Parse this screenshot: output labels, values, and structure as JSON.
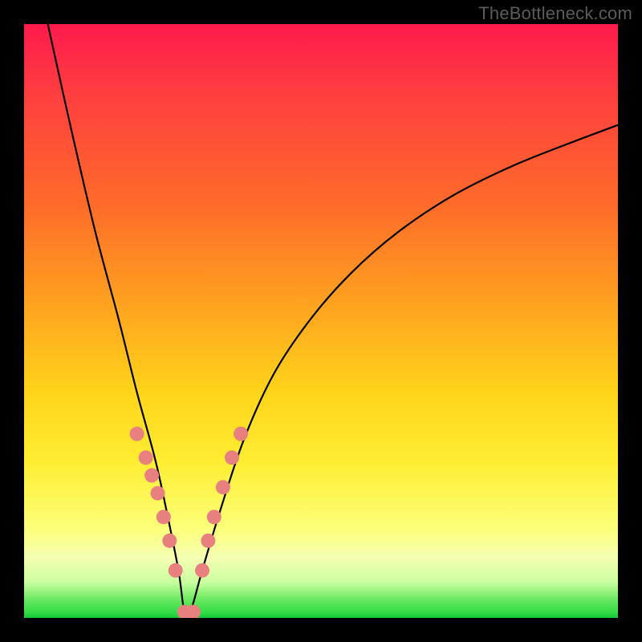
{
  "watermark": "TheBottleneck.com",
  "colors": {
    "frame": "#000000",
    "curve": "#000000",
    "dot": "#e98080",
    "gradient_top": "#ff1a4d",
    "gradient_bottom": "#15c93a"
  },
  "chart_data": {
    "type": "line",
    "title": "",
    "xlabel": "",
    "ylabel": "",
    "xlim": [
      0,
      100
    ],
    "ylim": [
      0,
      100
    ],
    "grid": false,
    "legend": false,
    "note": "Axes have no visible tick labels; values are estimated on a 0–100 scale from pixel positions. Curve is a V-shaped bottleneck profile with its minimum near x≈27, y≈0.",
    "series": [
      {
        "name": "bottleneck-curve",
        "x": [
          4,
          8,
          12,
          16,
          19,
          22,
          24,
          26,
          27,
          28,
          30,
          33,
          37,
          42,
          48,
          55,
          63,
          72,
          82,
          92,
          100
        ],
        "y": [
          100,
          82,
          65,
          50,
          38,
          27,
          18,
          8,
          1,
          1,
          8,
          18,
          30,
          41,
          50,
          58,
          65,
          71,
          76,
          80,
          83
        ]
      }
    ],
    "markers": {
      "name": "highlighted-points",
      "note": "Pink dots clustered near the valley of the curve.",
      "x": [
        19,
        20.5,
        21.5,
        22.5,
        23.5,
        24.5,
        25.5,
        27,
        28.5,
        30,
        31,
        32,
        33.5,
        35,
        36.5
      ],
      "y": [
        31,
        27,
        24,
        21,
        17,
        13,
        8,
        1,
        1,
        8,
        13,
        17,
        22,
        27,
        31
      ]
    }
  }
}
